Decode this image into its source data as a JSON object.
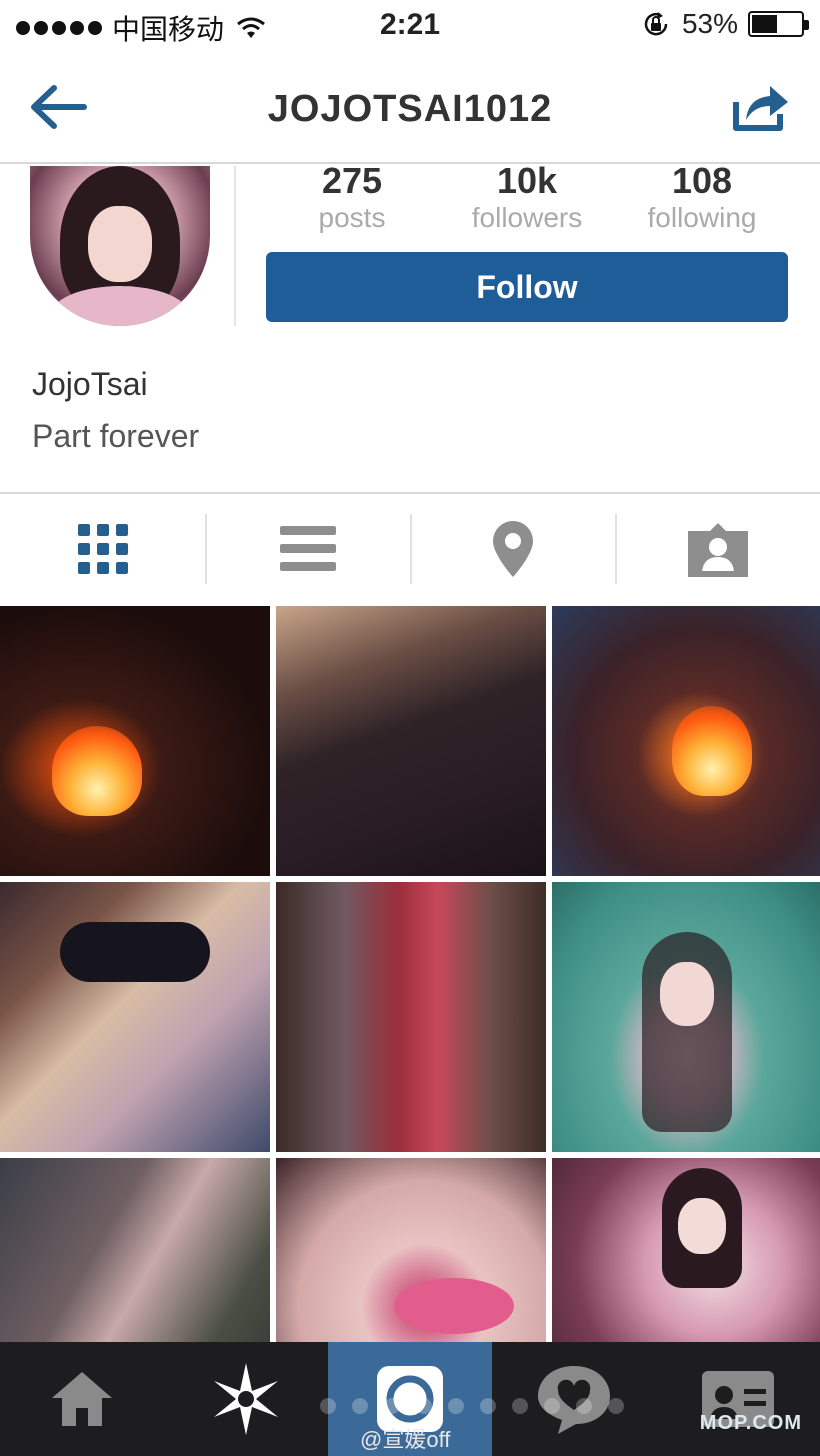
{
  "status_bar": {
    "carrier": "中国移动",
    "time": "2:21",
    "battery_percent": "53%",
    "battery_level": 0.53,
    "icons": [
      "signal-dots-icon",
      "wifi-icon",
      "rotation-lock-icon",
      "battery-icon"
    ]
  },
  "nav": {
    "title": "JOJOTSAI1012",
    "back_icon": "back-arrow-icon",
    "share_icon": "share-icon"
  },
  "profile": {
    "stats": [
      {
        "value": "275",
        "label": "posts"
      },
      {
        "value": "10k",
        "label": "followers"
      },
      {
        "value": "108",
        "label": "following"
      }
    ],
    "follow_label": "Follow",
    "full_name": "JojoTsai",
    "bio": "Part forever"
  },
  "view_tabs": [
    {
      "icon": "grid-icon",
      "active": true
    },
    {
      "icon": "list-icon",
      "active": false
    },
    {
      "icon": "location-pin-icon",
      "active": false
    },
    {
      "icon": "tagged-person-icon",
      "active": false
    }
  ],
  "tab_bar": {
    "items": [
      "home-icon",
      "explore-star-icon",
      "camera-icon",
      "activity-heart-icon",
      "profile-card-icon"
    ],
    "active_index": 2
  },
  "watermarks": {
    "weibo": "@宣媛off",
    "site": "MOP.COM"
  },
  "colors": {
    "accent": "#1f5d99",
    "active_tab": "#3b6a99",
    "tab_bar_bg": "#1d1d1f",
    "icon_blue": "#245f8f",
    "icon_gray": "#8e8e8e"
  }
}
